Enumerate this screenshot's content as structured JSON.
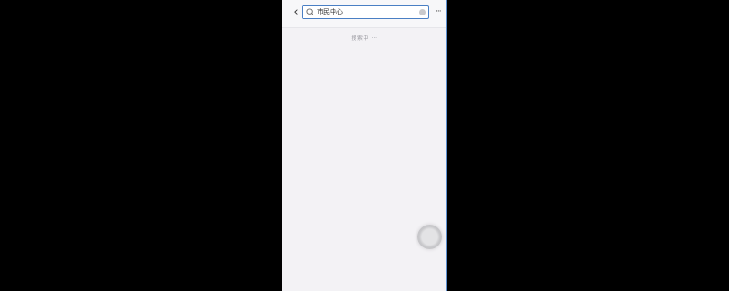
{
  "search": {
    "value": "市民中心",
    "back_glyph": "‹",
    "more_glyph": "···"
  },
  "status": {
    "loading_text": "搜索中 ···"
  },
  "icons": [
    "back-icon",
    "search-icon",
    "clear-icon",
    "more-icon",
    "floating-assist-button"
  ],
  "colors": {
    "page_bg": "#f3f2f5",
    "accent": "#4a7fc4",
    "backdrop": "#000000"
  }
}
